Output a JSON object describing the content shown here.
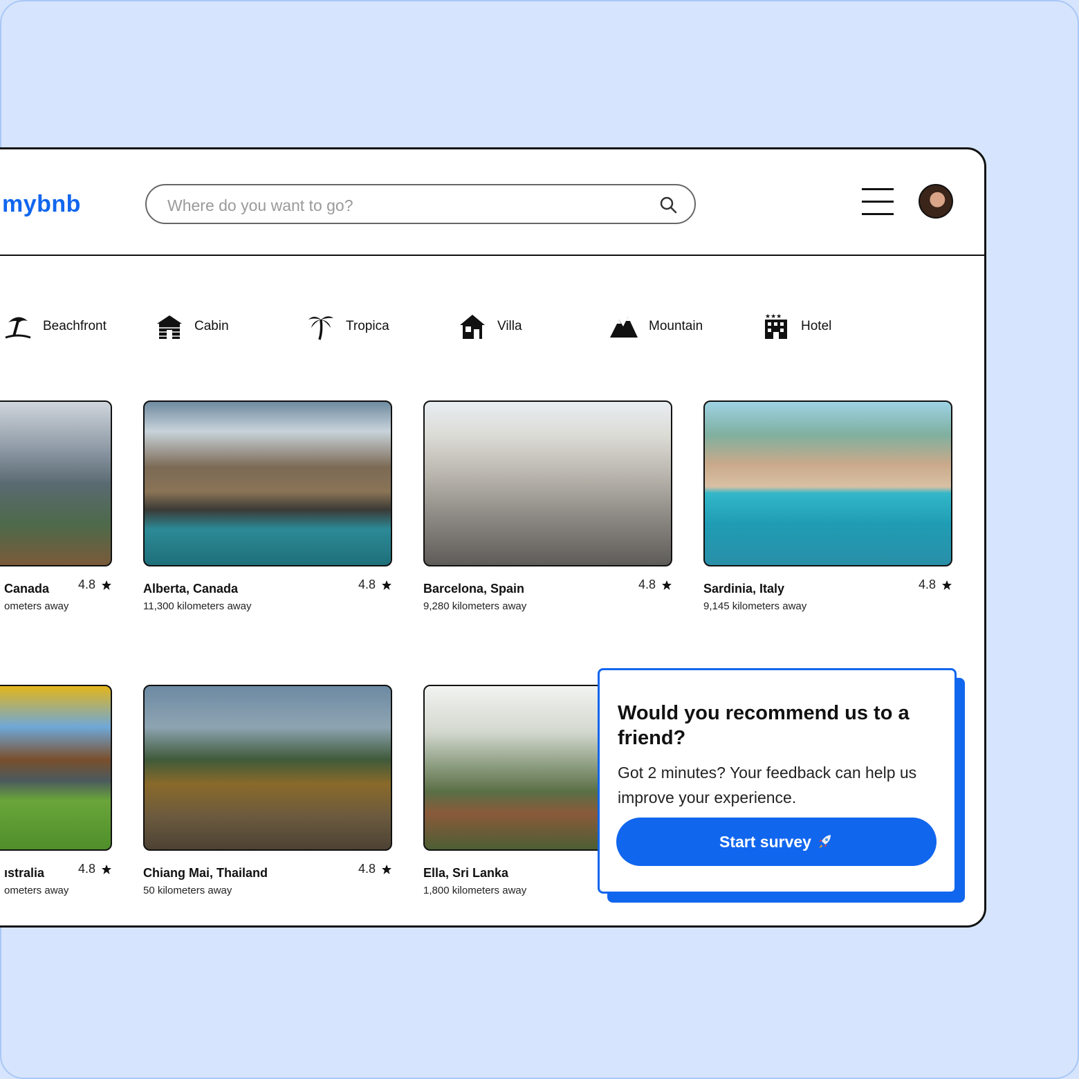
{
  "app": {
    "logo": "mybnb"
  },
  "search": {
    "placeholder": "Where do you want to go?"
  },
  "categories": [
    {
      "label": "Beachfront",
      "icon": "beach-umbrella-icon"
    },
    {
      "label": "Cabin",
      "icon": "cabin-icon"
    },
    {
      "label": "Tropica",
      "icon": "palm-tree-icon"
    },
    {
      "label": "Villa",
      "icon": "villa-house-icon"
    },
    {
      "label": "Mountain",
      "icon": "mountain-icon"
    },
    {
      "label": "Hotel",
      "icon": "hotel-icon"
    }
  ],
  "listings": [
    {
      "title": "Canada",
      "distance": "ometers away",
      "rating": "4.8"
    },
    {
      "title": "Alberta, Canada",
      "distance": "11,300 kilometers away",
      "rating": "4.8"
    },
    {
      "title": "Barcelona, Spain",
      "distance": "9,280 kilometers away",
      "rating": "4.8"
    },
    {
      "title": "Sardinia, Italy",
      "distance": "9,145 kilometers away",
      "rating": "4.8"
    },
    {
      "title": "ıstralia",
      "distance": "ometers away",
      "rating": "4.8"
    },
    {
      "title": "Chiang Mai, Thailand",
      "distance": "50 kilometers away",
      "rating": "4.8"
    },
    {
      "title": "Ella, Sri Lanka",
      "distance": "1,800 kilometers away",
      "rating": ""
    }
  ],
  "survey": {
    "question": "Would you recommend us to a friend?",
    "subtitle": "Got 2 minutes? Your feedback can help us improve your experience.",
    "button_label": "Start survey",
    "button_icon": "rocket-icon"
  },
  "colors": {
    "brand": "#1166ee",
    "background": "#d6e5fd"
  }
}
